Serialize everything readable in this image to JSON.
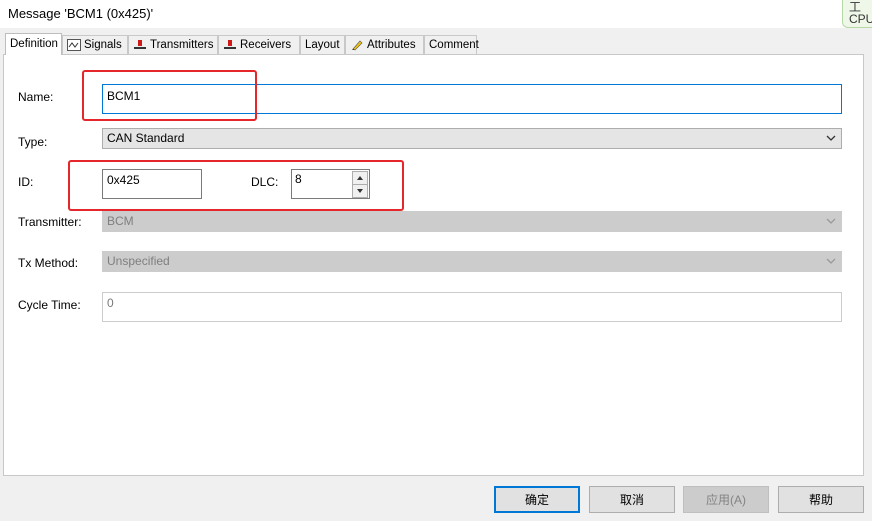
{
  "window": {
    "title": "Message 'BCM1 (0x425)'",
    "corner_text": "工\nCPU"
  },
  "tabs": [
    {
      "label": "Definition",
      "icon": "none",
      "active": true
    },
    {
      "label": "Signals",
      "icon": "signal-wave-icon"
    },
    {
      "label": "Transmitters",
      "icon": "red-node-icon"
    },
    {
      "label": "Receivers",
      "icon": "red-node-icon"
    },
    {
      "label": "Layout",
      "icon": "none"
    },
    {
      "label": "Attributes",
      "icon": "pencil-icon"
    },
    {
      "label": "Comment",
      "icon": "none"
    }
  ],
  "form": {
    "name_label": "Name:",
    "name_value": "BCM1",
    "type_label": "Type:",
    "type_value": "CAN Standard",
    "id_label": "ID:",
    "id_value": "0x425",
    "dlc_label": "DLC:",
    "dlc_value": "8",
    "transmitter_label": "Transmitter:",
    "transmitter_value": "BCM",
    "txmethod_label": "Tx Method:",
    "txmethod_value": "Unspecified",
    "cycle_label": "Cycle Time:",
    "cycle_value": "0"
  },
  "buttons": {
    "ok": "确定",
    "cancel": "取消",
    "apply": "应用(A)",
    "help": "帮助"
  },
  "colors": {
    "highlight_box": "#e5262a",
    "focus_border": "#0078d7"
  }
}
